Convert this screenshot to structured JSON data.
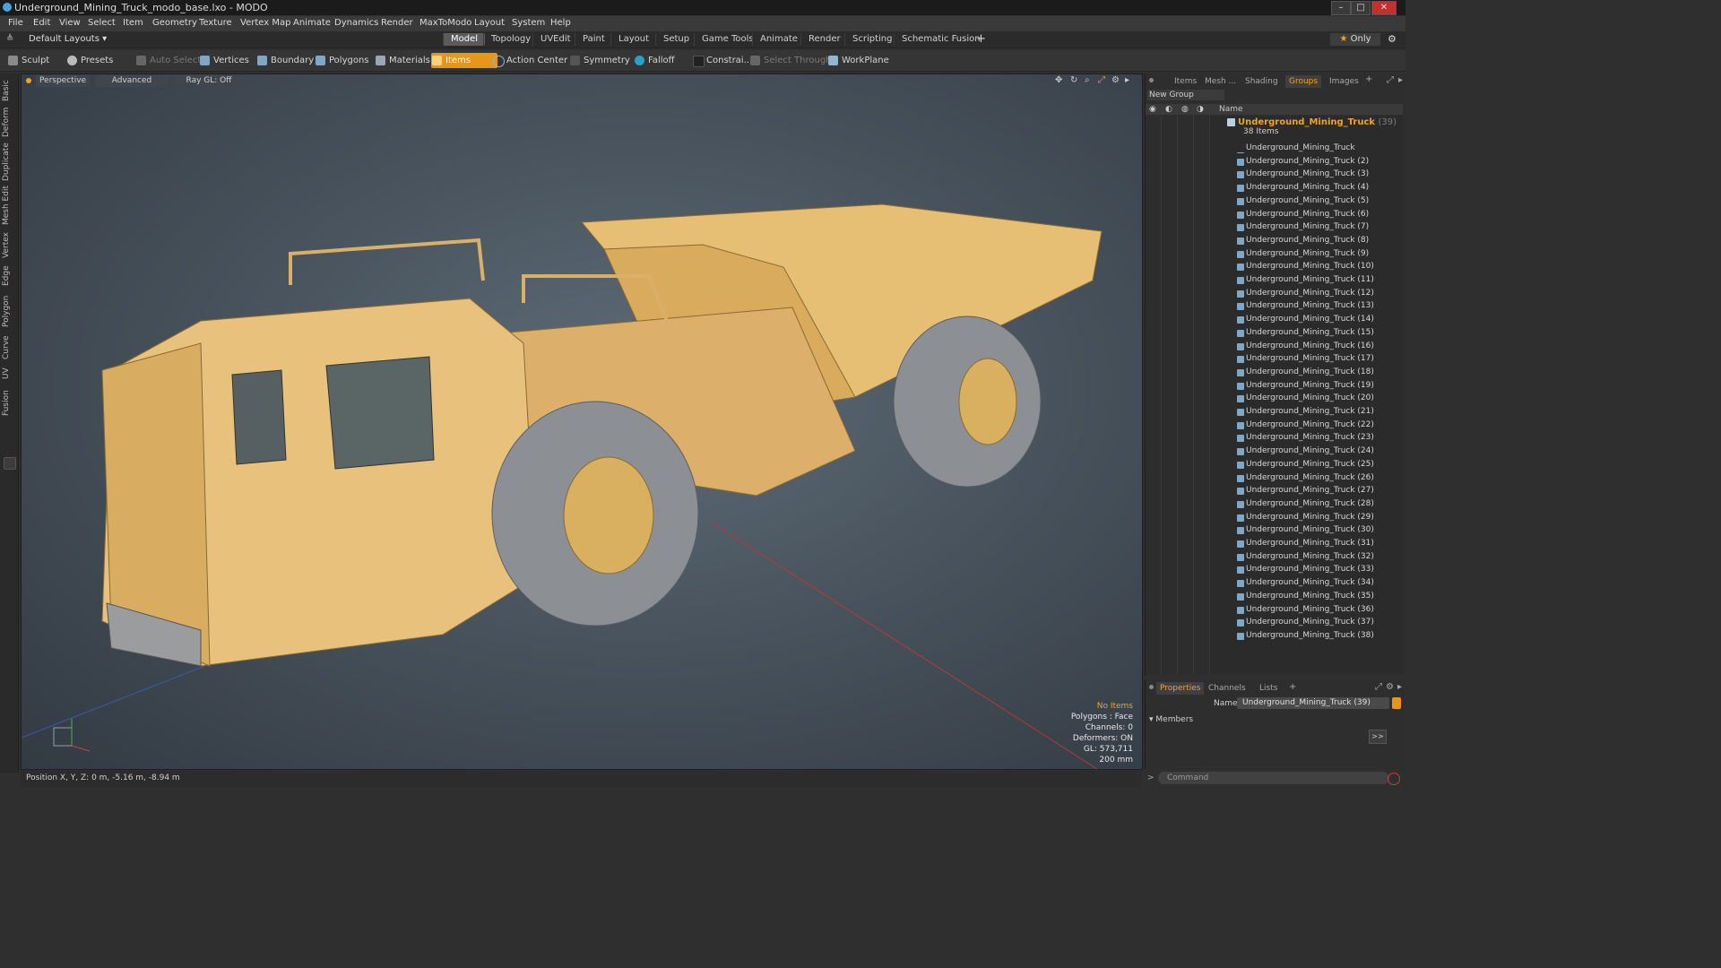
{
  "window": {
    "title": "Underground_Mining_Truck_modo_base.lxo - MODO"
  },
  "menu": [
    "File",
    "Edit",
    "View",
    "Select",
    "Item",
    "Geometry",
    "Texture",
    "Vertex Map",
    "Animate",
    "Dynamics",
    "Render",
    "MaxToModo",
    "Layout",
    "System",
    "Help"
  ],
  "layouts": {
    "default_label": "Default Layouts",
    "tabs": [
      "Model",
      "Topology",
      "UVEdit",
      "Paint",
      "Layout",
      "Setup",
      "Game Tools",
      "Animate",
      "Render",
      "Scripting",
      "Schematic Fusion"
    ],
    "active": "Model",
    "only_label": "Only"
  },
  "toolbar": {
    "sculpt": "Sculpt",
    "presets": "Presets",
    "auto_select": "Auto Select",
    "vertices": "Vertices",
    "boundary": "Boundary",
    "polygons": "Polygons",
    "materials": "Materials",
    "items": "Items",
    "action_center": "Action Center",
    "symmetry": "Symmetry",
    "falloff": "Falloff",
    "constraints": "Constrai...",
    "select_through": "Select Through",
    "workplane": "WorkPlane"
  },
  "left_tabs": [
    "Basic",
    "Deform",
    "Duplicate",
    "Mesh Edit",
    "Vertex",
    "Edge",
    "Polygon",
    "Curve",
    "UV",
    "Fusion"
  ],
  "viewport": {
    "perspective": "Perspective",
    "advanced": "Advanced",
    "raygl": "Ray GL: Off",
    "info": {
      "items": "No Items",
      "polygons": "Polygons : Face",
      "channels": "Channels: 0",
      "deformers": "Deformers: ON",
      "gl": "GL: 573,711",
      "scale": "200 mm"
    },
    "model_color": "#e8c07a"
  },
  "status": {
    "position": "Position X, Y, Z:  0 m, -5.16 m, -8.94 m"
  },
  "panel_tabs": [
    "Items",
    "Mesh ...",
    "Shading",
    "Groups",
    "Images"
  ],
  "panel_active": "Groups",
  "groups": {
    "new_group": "New Group",
    "name_header": "Name",
    "group_name": "Underground_Mining_Truck",
    "group_count": "(39)",
    "item_count": "38 Items",
    "items": [
      "Underground_Mining_Truck",
      "Underground_Mining_Truck (2)",
      "Underground_Mining_Truck (3)",
      "Underground_Mining_Truck (4)",
      "Underground_Mining_Truck (5)",
      "Underground_Mining_Truck (6)",
      "Underground_Mining_Truck (7)",
      "Underground_Mining_Truck (8)",
      "Underground_Mining_Truck (9)",
      "Underground_Mining_Truck (10)",
      "Underground_Mining_Truck (11)",
      "Underground_Mining_Truck (12)",
      "Underground_Mining_Truck (13)",
      "Underground_Mining_Truck (14)",
      "Underground_Mining_Truck (15)",
      "Underground_Mining_Truck (16)",
      "Underground_Mining_Truck (17)",
      "Underground_Mining_Truck (18)",
      "Underground_Mining_Truck (19)",
      "Underground_Mining_Truck (20)",
      "Underground_Mining_Truck (21)",
      "Underground_Mining_Truck (22)",
      "Underground_Mining_Truck (23)",
      "Underground_Mining_Truck (24)",
      "Underground_Mining_Truck (25)",
      "Underground_Mining_Truck (26)",
      "Underground_Mining_Truck (27)",
      "Underground_Mining_Truck (28)",
      "Underground_Mining_Truck (29)",
      "Underground_Mining_Truck (30)",
      "Underground_Mining_Truck (31)",
      "Underground_Mining_Truck (32)",
      "Underground_Mining_Truck (33)",
      "Underground_Mining_Truck (34)",
      "Underground_Mining_Truck (35)",
      "Underground_Mining_Truck (36)",
      "Underground_Mining_Truck (37)",
      "Underground_Mining_Truck (38)"
    ]
  },
  "properties": {
    "tabs": [
      "Properties",
      "Channels",
      "Lists"
    ],
    "active": "Properties",
    "name_label": "Name",
    "name_value": "Underground_Mining_Truck (39)",
    "members": "Members",
    "more": ">>"
  },
  "command": {
    "placeholder": "Command"
  },
  "colors": {
    "accent": "#e8951c",
    "group_text": "#f0a32a"
  }
}
